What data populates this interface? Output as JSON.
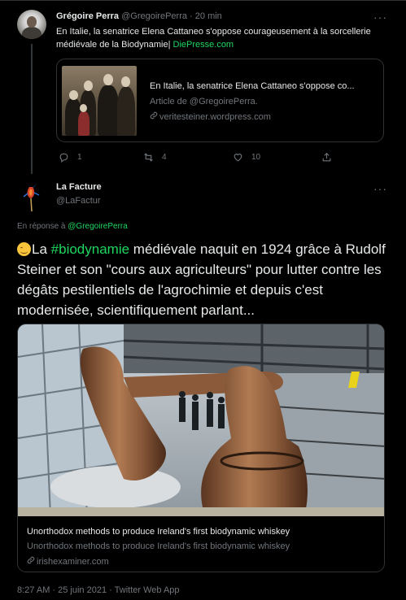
{
  "reply": {
    "author_name": "Grégoire Perra",
    "author_handle": "@GregoirePerra",
    "separator": "·",
    "time": "20 min",
    "text_before": "En Italie, la senatrice Elena Cattaneo s'oppose courageusement à la sorcellerie médiévale de la Biodynamie|",
    "text_link": "DiePresse.com",
    "card": {
      "title": "En Italie, la senatrice Elena Cattaneo s'oppose co...",
      "subtitle": "Article de @GregoirePerra.",
      "domain": "veritesteiner.wordpress.com"
    },
    "actions": {
      "replies": "1",
      "retweets": "4",
      "likes": "10"
    }
  },
  "tweet": {
    "author_name": "La Facture",
    "author_handle": "@LaFactur",
    "replying_prefix": "En réponse à",
    "replying_to": "@GregoirePerra",
    "text_before": "La",
    "hashtag": "#biodynamie",
    "text_after": "médiévale naquit en 1924 grâce à Rudolf Steiner et son \"cours aux agriculteurs\" pour lutter contre les dégâts pestilentiels de l'agrochimie et depuis c'est modernisée, scientifiquement parlant...",
    "card": {
      "title": "Unorthodox methods to produce Ireland's first biodynamic whiskey",
      "subtitle": "Unorthodox methods to produce Ireland's first biodynamic whiskey",
      "domain": "irishexaminer.com"
    },
    "timestamp": "8:27 AM · 25 juin 2021 · Twitter Web App"
  },
  "icons": [
    "more-icon",
    "link-icon",
    "reply-icon",
    "retweet-icon",
    "like-icon",
    "share-icon",
    "relieved-emoji-icon"
  ],
  "colors": {
    "background": "#000000",
    "text": "#e7e9ea",
    "muted": "#71767b",
    "link": "#1ed760",
    "border": "#2f3336"
  }
}
